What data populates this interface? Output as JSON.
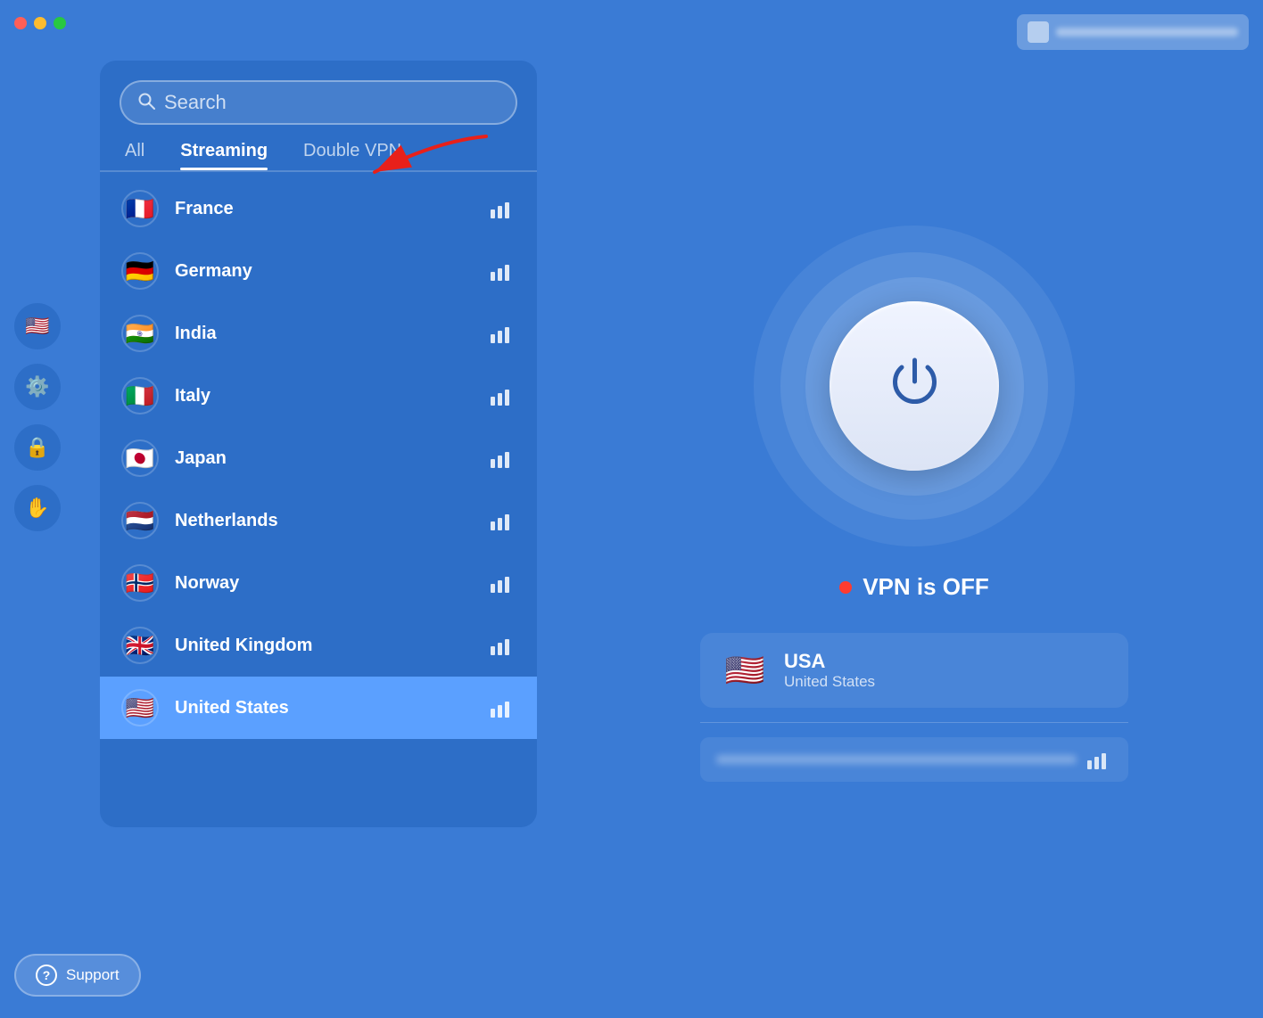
{
  "titlebar": {
    "close_label": "close",
    "min_label": "minimize",
    "max_label": "maximize"
  },
  "search": {
    "placeholder": "Search"
  },
  "tabs": [
    {
      "id": "all",
      "label": "All",
      "active": false
    },
    {
      "id": "streaming",
      "label": "Streaming",
      "active": true
    },
    {
      "id": "double-vpn",
      "label": "Double VPN",
      "active": false
    }
  ],
  "countries": [
    {
      "name": "France",
      "flag": "🇫🇷",
      "selected": false,
      "bars": [
        3,
        4,
        4
      ]
    },
    {
      "name": "Germany",
      "flag": "🇩🇪",
      "selected": false,
      "bars": [
        3,
        4,
        4
      ]
    },
    {
      "name": "India",
      "flag": "🇮🇳",
      "selected": false,
      "bars": [
        2,
        4,
        4
      ]
    },
    {
      "name": "Italy",
      "flag": "🇮🇹",
      "selected": false,
      "bars": [
        3,
        4,
        4
      ]
    },
    {
      "name": "Japan",
      "flag": "🇯🇵",
      "selected": false,
      "bars": [
        2,
        3,
        4
      ]
    },
    {
      "name": "Netherlands",
      "flag": "🇳🇱",
      "selected": false,
      "bars": [
        3,
        4,
        4
      ]
    },
    {
      "name": "Norway",
      "flag": "🇳🇴",
      "selected": false,
      "bars": [
        3,
        4,
        4
      ]
    },
    {
      "name": "United Kingdom",
      "flag": "🇬🇧",
      "selected": false,
      "bars": [
        2,
        4,
        4
      ]
    },
    {
      "name": "United States",
      "flag": "🇺🇸",
      "selected": true,
      "bars": [
        3,
        4,
        4
      ]
    }
  ],
  "sidebar_icons": [
    {
      "id": "flag",
      "icon": "🇺🇸"
    },
    {
      "id": "settings",
      "icon": "⚙️"
    },
    {
      "id": "lock",
      "icon": "🔒"
    },
    {
      "id": "hand",
      "icon": "✋"
    }
  ],
  "vpn_status": {
    "dot_color": "#ff3b30",
    "text": "VPN is OFF"
  },
  "selected_country": {
    "code": "USA",
    "full_name": "United States",
    "flag": "🇺🇸"
  },
  "support": {
    "label": "Support"
  },
  "power_button": {
    "aria_label": "Connect VPN"
  }
}
